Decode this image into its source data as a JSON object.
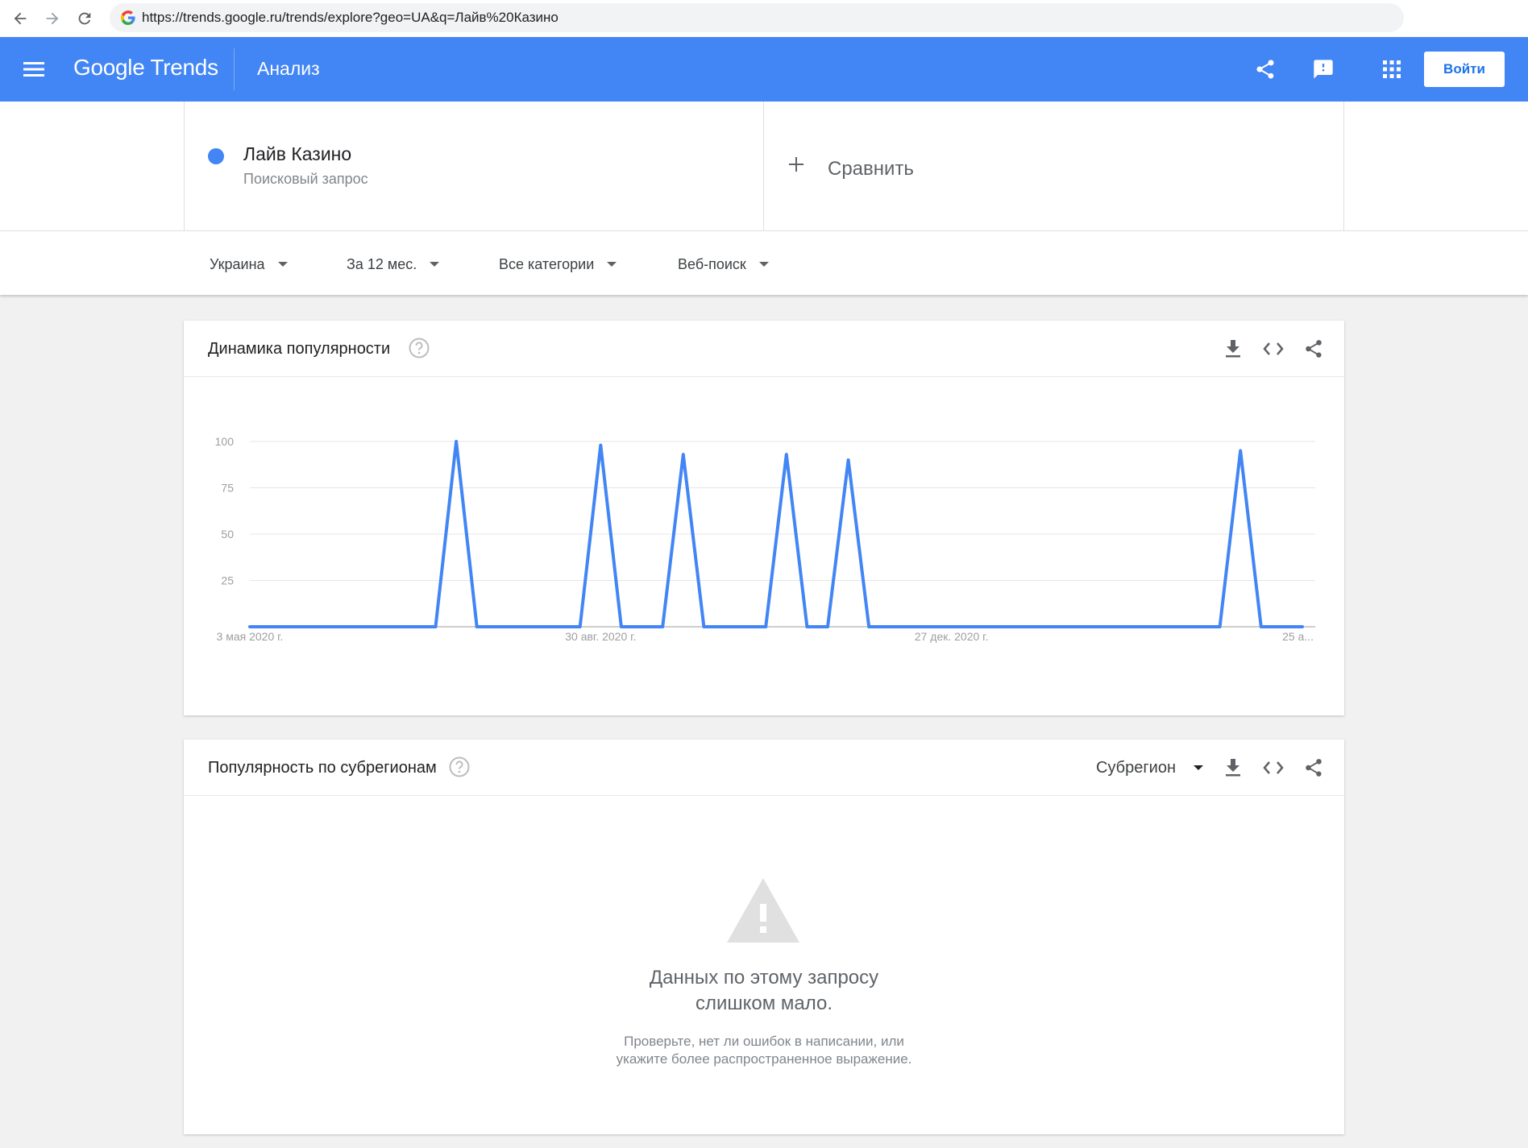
{
  "browser": {
    "url": "https://trends.google.ru/trends/explore?geo=UA&q=Лайв%20Казино"
  },
  "header": {
    "logo": "Google Trends",
    "title": "Анализ",
    "login_label": "Войти"
  },
  "terms": {
    "term_name": "Лайв Казино",
    "term_type": "Поисковый запрос",
    "compare_label": "Сравнить",
    "term_color": "#4285f4"
  },
  "filters": {
    "region": "Украина",
    "period": "За 12 мес.",
    "category": "Все категории",
    "search_type": "Веб-поиск"
  },
  "interest_card": {
    "title": "Динамика популярности"
  },
  "subregion_card": {
    "title": "Популярность по субрегионам",
    "select_label": "Субрегион",
    "empty_title_line1": "Данных по этому запросу",
    "empty_title_line2": "слишком мало.",
    "empty_sub_line1": "Проверьте, нет ли ошибок в написании, или",
    "empty_sub_line2": "укажите более распространенное выражение."
  },
  "chart_data": {
    "type": "line",
    "title": "",
    "xlabel": "",
    "ylabel": "",
    "ylim": [
      0,
      100
    ],
    "yticks": [
      25,
      50,
      75,
      100
    ],
    "x_tick_labels": [
      "3 мая 2020 г.",
      "30 авг. 2020 г.",
      "27 дек. 2020 г.",
      "25 а..."
    ],
    "x_tick_index": [
      0,
      17,
      34,
      51
    ],
    "grid": true,
    "color": "#4285f4",
    "series": [
      {
        "values": [
          0,
          0,
          0,
          0,
          0,
          0,
          0,
          0,
          0,
          0,
          100,
          0,
          0,
          0,
          0,
          0,
          0,
          98,
          0,
          0,
          0,
          93,
          0,
          0,
          0,
          0,
          93,
          0,
          0,
          90,
          0,
          0,
          0,
          0,
          0,
          0,
          0,
          0,
          0,
          0,
          0,
          0,
          0,
          0,
          0,
          0,
          0,
          0,
          95,
          0,
          0,
          0
        ]
      }
    ]
  }
}
